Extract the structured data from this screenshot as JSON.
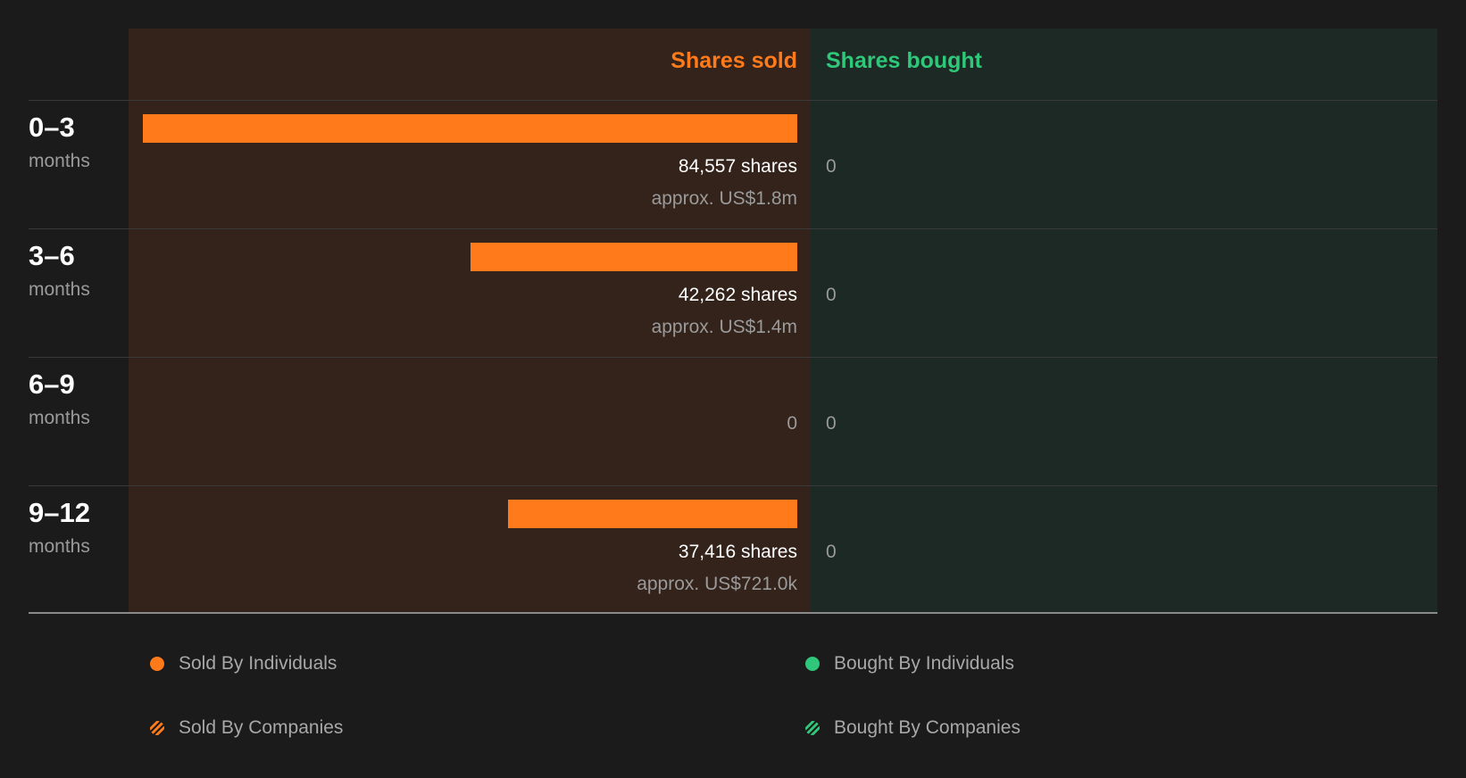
{
  "colors": {
    "background": "#1b1b1b",
    "sold_panel": "#33231a",
    "bought_panel": "#1c2924",
    "sold_accent": "#ff7a1a",
    "bought_accent": "#2fc77a"
  },
  "chart_data": {
    "type": "bar",
    "orientation": "horizontal-diverging",
    "headers": {
      "sold": "Shares sold",
      "bought": "Shares bought"
    },
    "categories": [
      {
        "range": "0–3",
        "unit": "months"
      },
      {
        "range": "3–6",
        "unit": "months"
      },
      {
        "range": "6–9",
        "unit": "months"
      },
      {
        "range": "9–12",
        "unit": "months"
      }
    ],
    "series": [
      {
        "name": "Sold By Individuals",
        "values": [
          84557,
          42262,
          0,
          37416
        ],
        "labels": [
          "84,557 shares",
          "42,262 shares",
          "0",
          "37,416 shares"
        ],
        "approx": [
          "approx. US$1.8m",
          "approx. US$1.4m",
          "",
          "approx. US$721.0k"
        ]
      },
      {
        "name": "Bought By Individuals",
        "values": [
          0,
          0,
          0,
          0
        ],
        "labels": [
          "0",
          "0",
          "0",
          "0"
        ]
      }
    ],
    "xlim": [
      0,
      84557
    ],
    "legend": [
      {
        "label": "Sold By Individuals",
        "icon": "solid-dot-icon",
        "color": "#ff7a1a"
      },
      {
        "label": "Bought By Individuals",
        "icon": "solid-dot-icon",
        "color": "#2fc77a"
      },
      {
        "label": "Sold By Companies",
        "icon": "striped-dot-icon",
        "color": "#ff7a1a"
      },
      {
        "label": "Bought By Companies",
        "icon": "striped-dot-icon",
        "color": "#2fc77a"
      }
    ]
  }
}
